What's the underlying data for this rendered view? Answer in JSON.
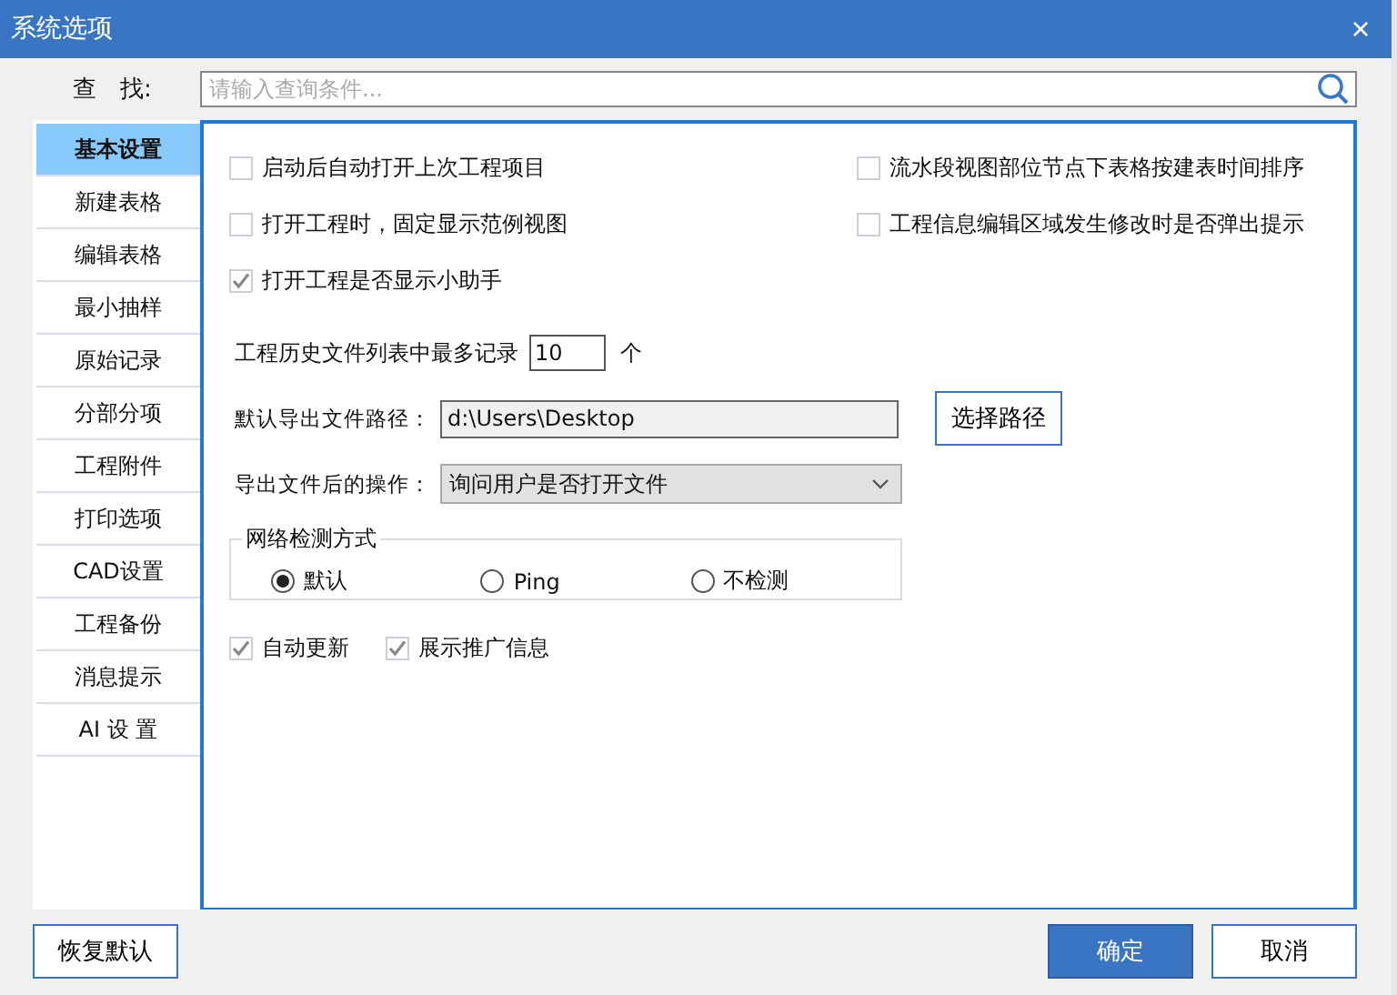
{
  "window": {
    "title": "系统选项",
    "close": "×"
  },
  "search": {
    "label": "查　找:",
    "placeholder": "请输入查询条件..."
  },
  "sidebar": {
    "items": [
      {
        "label": "基本设置",
        "selected": true
      },
      {
        "label": "新建表格",
        "selected": false
      },
      {
        "label": "编辑表格",
        "selected": false
      },
      {
        "label": "最小抽样",
        "selected": false
      },
      {
        "label": "原始记录",
        "selected": false
      },
      {
        "label": "分部分项",
        "selected": false
      },
      {
        "label": "工程附件",
        "selected": false
      },
      {
        "label": "打印选项",
        "selected": false
      },
      {
        "label": "CAD设置",
        "selected": false
      },
      {
        "label": "工程备份",
        "selected": false
      },
      {
        "label": "消息提示",
        "selected": false
      },
      {
        "label": "AI 设 置",
        "selected": false
      }
    ]
  },
  "options": [
    {
      "label": "启动后自动打开上次工程项目",
      "checked": false
    },
    {
      "label": "流水段视图部位节点下表格按建表时间排序",
      "checked": false
    },
    {
      "label": "打开工程时，固定显示范例视图",
      "checked": false
    },
    {
      "label": "工程信息编辑区域发生修改时是否弹出提示",
      "checked": false
    },
    {
      "label": "打开工程是否显示小助手",
      "checked": true
    }
  ],
  "history": {
    "label": "工程历史文件列表中最多记录",
    "value": "10",
    "unit": "个"
  },
  "export_path": {
    "label": "默认导出文件路径：",
    "value": "d:\\Users\\Desktop",
    "button": "选择路径"
  },
  "after_export": {
    "label": "导出文件后的操作：",
    "value": "询问用户是否打开文件"
  },
  "network": {
    "legend": "网络检测方式",
    "options": [
      {
        "label": "默认",
        "selected": true
      },
      {
        "label": "Ping",
        "selected": false
      },
      {
        "label": "不检测",
        "selected": false
      }
    ]
  },
  "extra_options": [
    {
      "label": "自动更新",
      "checked": true
    },
    {
      "label": "展示推广信息",
      "checked": true
    }
  ],
  "footer": {
    "buttons": [
      {
        "label": "恢复默认",
        "kind": "left"
      },
      {
        "label": "确定",
        "kind": "primary"
      },
      {
        "label": "取消",
        "kind": "normal"
      }
    ]
  }
}
